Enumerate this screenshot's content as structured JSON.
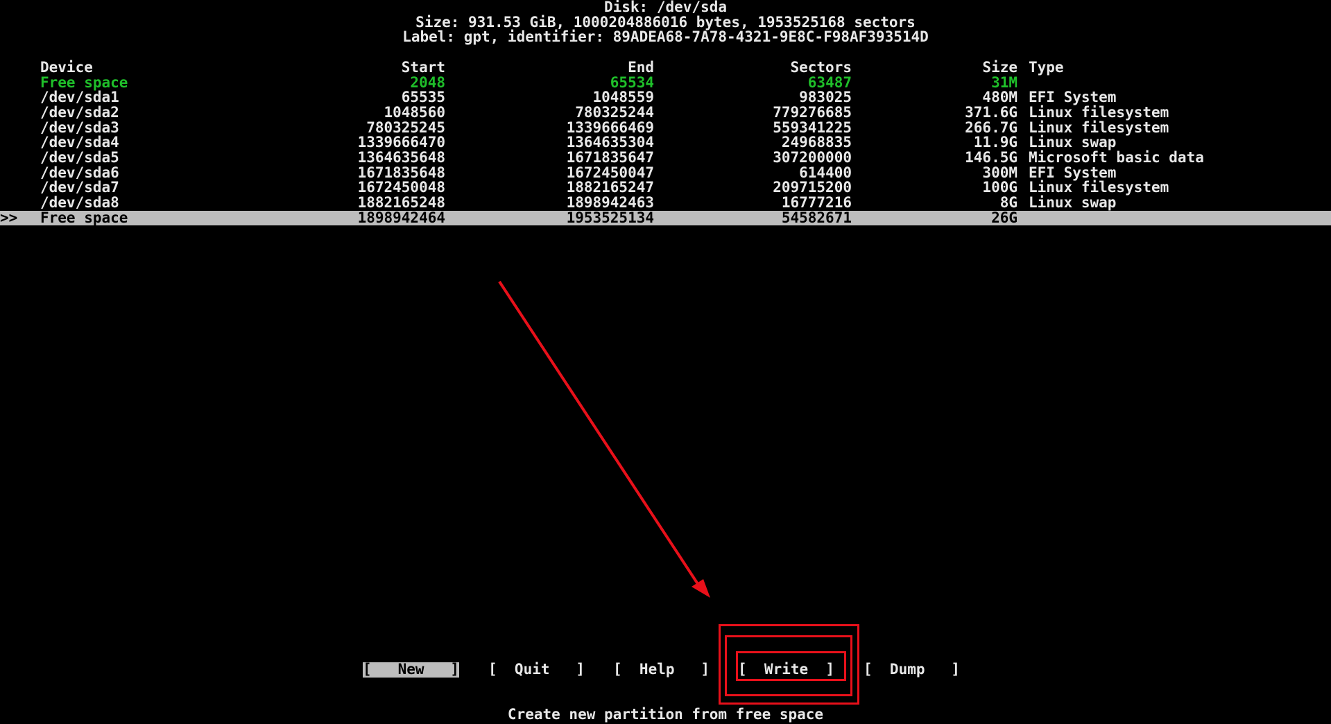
{
  "header": {
    "title": "Disk: /dev/sda",
    "size_line": "Size: 931.53 GiB, 1000204886016 bytes, 1953525168 sectors",
    "label_line": "Label: gpt, identifier: 89ADEA68-7A78-4321-9E8C-F98AF393514D"
  },
  "table": {
    "columns": {
      "device": "Device",
      "start": "Start",
      "end": "End",
      "sectors": "Sectors",
      "size": "Size",
      "type": "Type"
    },
    "rows": [
      {
        "pointer": "",
        "device": "Free space",
        "start": "2048",
        "end": "65534",
        "sectors": "63487",
        "size": "31M",
        "type": ""
      },
      {
        "pointer": "",
        "device": "/dev/sda1",
        "start": "65535",
        "end": "1048559",
        "sectors": "983025",
        "size": "480M",
        "type": "EFI System"
      },
      {
        "pointer": "",
        "device": "/dev/sda2",
        "start": "1048560",
        "end": "780325244",
        "sectors": "779276685",
        "size": "371.6G",
        "type": "Linux filesystem"
      },
      {
        "pointer": "",
        "device": "/dev/sda3",
        "start": "780325245",
        "end": "1339666469",
        "sectors": "559341225",
        "size": "266.7G",
        "type": "Linux filesystem"
      },
      {
        "pointer": "",
        "device": "/dev/sda4",
        "start": "1339666470",
        "end": "1364635304",
        "sectors": "24968835",
        "size": "11.9G",
        "type": "Linux swap"
      },
      {
        "pointer": "",
        "device": "/dev/sda5",
        "start": "1364635648",
        "end": "1671835647",
        "sectors": "307200000",
        "size": "146.5G",
        "type": "Microsoft basic data"
      },
      {
        "pointer": "",
        "device": "/dev/sda6",
        "start": "1671835648",
        "end": "1672450047",
        "sectors": "614400",
        "size": "300M",
        "type": "EFI System"
      },
      {
        "pointer": "",
        "device": "/dev/sda7",
        "start": "1672450048",
        "end": "1882165247",
        "sectors": "209715200",
        "size": "100G",
        "type": "Linux filesystem"
      },
      {
        "pointer": "",
        "device": "/dev/sda8",
        "start": "1882165248",
        "end": "1898942463",
        "sectors": "16777216",
        "size": "8G",
        "type": "Linux swap"
      },
      {
        "pointer": ">>",
        "device": "Free space",
        "start": "1898942464",
        "end": "1953525134",
        "sectors": "54582671",
        "size": "26G",
        "type": ""
      }
    ]
  },
  "menu": {
    "new": "[   New   ]",
    "quit": "[  Quit   ]",
    "help": "[  Help   ]",
    "write": "[  Write  ]",
    "dump": "[  Dump   ]",
    "active": "new"
  },
  "hint": "Create new partition from free space",
  "colors": {
    "background": "#000000",
    "text": "#e8e8e8",
    "free_space_green": "#1fbf2a",
    "selection_bar": "#bdbdbd",
    "annotation_red": "#e8101a"
  }
}
